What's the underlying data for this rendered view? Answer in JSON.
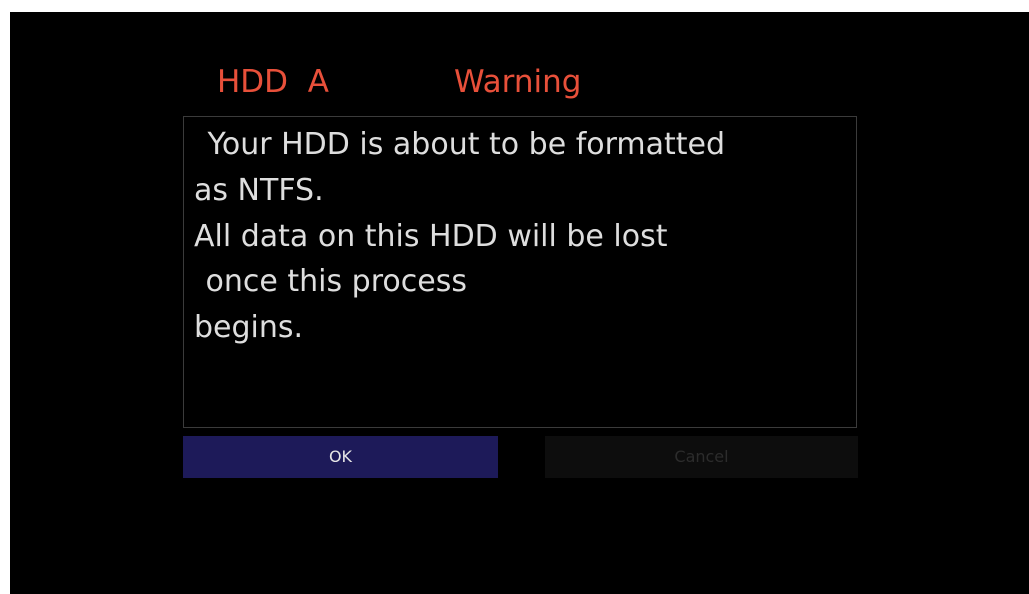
{
  "dialog": {
    "drive_label": "HDD  A",
    "title": "Warning",
    "message_lines": [
      " Your HDD is about to be formatted",
      "as NTFS.",
      "All data on this HDD will be lost",
      " once this process",
      "begins."
    ],
    "ok_label": "OK",
    "cancel_label": "Cancel"
  },
  "colors": {
    "title_text": "#e8503a",
    "message_text": "#dedede",
    "ok_button_bg": "#1d1a59",
    "cancel_button_bg": "#0d0d0d",
    "screen_bg": "#000000"
  }
}
